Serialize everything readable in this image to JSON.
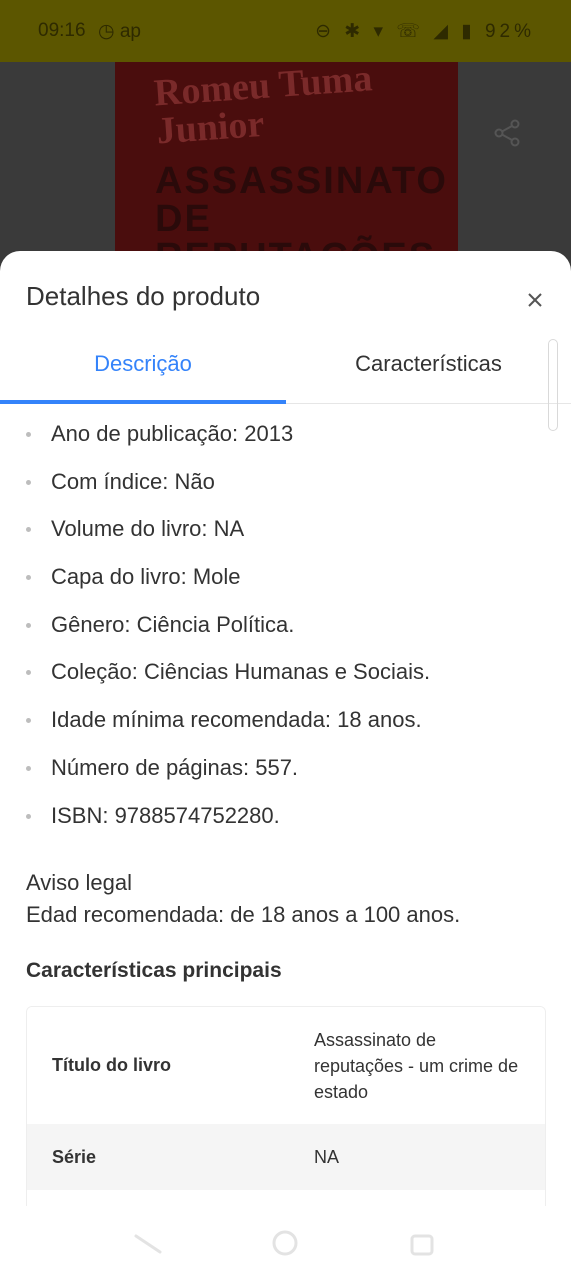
{
  "status_bar": {
    "time": "09:16",
    "left_icons": "◷ ap",
    "battery": "92%",
    "right_icons": "⊖ ✱ ▾ ☏ ◢ ▮"
  },
  "background": {
    "cover_author": "Romeu Tuma Junior",
    "cover_title": "ASSASSINATO DE REPUTAÇÕES"
  },
  "sheet": {
    "title": "Detalhes do produto",
    "tabs": [
      {
        "label": "Descrição",
        "active": true
      },
      {
        "label": "Características",
        "active": false
      }
    ],
    "specs": [
      "Ano de publicação: 2013",
      "Com índice: Não",
      "Volume do livro: NA",
      "Capa do livro: Mole",
      "Gênero: Ciência Política.",
      "Coleção: Ciências Humanas e Sociais.",
      "Idade mínima recomendada: 18 anos.",
      "Número de páginas: 557.",
      "ISBN: 9788574752280."
    ],
    "legal_title": "Aviso legal",
    "legal_text": "Edad recomendada: de 18 anos a 100 anos.",
    "features_heading": "Características principais",
    "features": [
      {
        "key": "Título do livro",
        "value": "Assassinato de reputações - um crime de estado"
      },
      {
        "key": "Série",
        "value": "NA"
      },
      {
        "key": "",
        "value": ""
      }
    ]
  },
  "colors": {
    "accent": "#3483fa",
    "text": "#333333",
    "status_bar": "#5c5600"
  },
  "icons": {
    "close": "close-icon",
    "share": "share-icon",
    "nav_back": "nav-back-icon",
    "nav_home": "nav-home-icon",
    "nav_recent": "nav-recent-icon"
  }
}
